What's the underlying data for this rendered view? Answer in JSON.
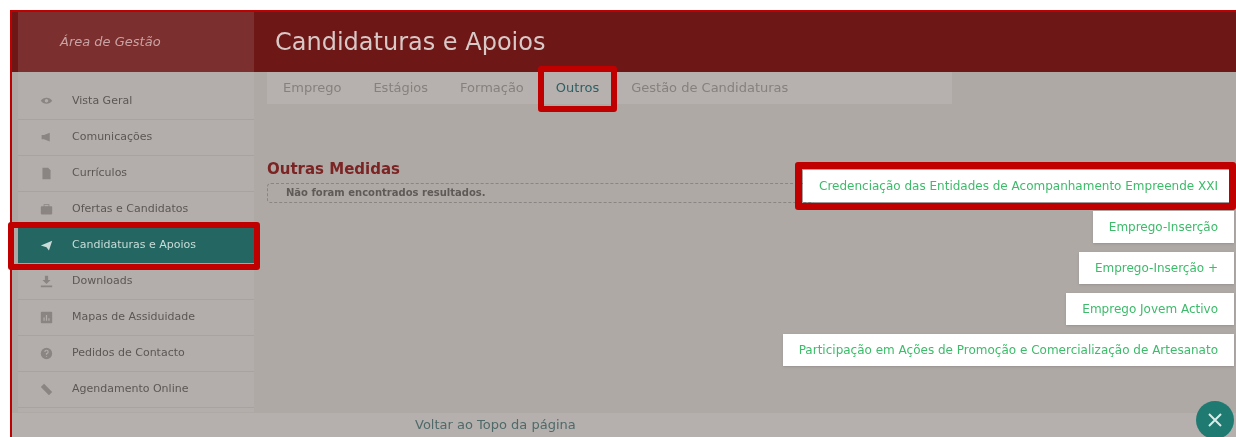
{
  "sidebar": {
    "title": "Área de Gestão",
    "items": [
      {
        "label": "Vista Geral",
        "selected": false,
        "highlighted": false
      },
      {
        "label": "Comunicações",
        "selected": false,
        "highlighted": false
      },
      {
        "label": "Currículos",
        "selected": false,
        "highlighted": false
      },
      {
        "label": "Ofertas e Candidatos",
        "selected": false,
        "highlighted": false
      },
      {
        "label": "Candidaturas e Apoios",
        "selected": true,
        "highlighted": true
      },
      {
        "label": "Downloads",
        "selected": false,
        "highlighted": false
      },
      {
        "label": "Mapas de Assiduidade",
        "selected": false,
        "highlighted": false
      },
      {
        "label": "Pedidos de Contacto",
        "selected": false,
        "highlighted": false
      },
      {
        "label": "Agendamento Online",
        "selected": false,
        "highlighted": false
      }
    ]
  },
  "header": {
    "title": "Candidaturas e Apoios"
  },
  "tabs": [
    {
      "label": "Emprego",
      "selected": false,
      "highlighted": false
    },
    {
      "label": "Estágios",
      "selected": false,
      "highlighted": false
    },
    {
      "label": "Formação",
      "selected": false,
      "highlighted": false
    },
    {
      "label": "Outros",
      "selected": true,
      "highlighted": true
    },
    {
      "label": "Gestão de Candidaturas",
      "selected": false,
      "highlighted": false
    }
  ],
  "section": {
    "title": "Outras Medidas",
    "empty_message": "Não foram encontrados resultados."
  },
  "measures": [
    {
      "label": "Credenciação das Entidades de Acompanhamento Empreende XXI",
      "highlighted": true
    },
    {
      "label": "Emprego-Inserção",
      "highlighted": false
    },
    {
      "label": "Emprego-Inserção +",
      "highlighted": false
    },
    {
      "label": "Emprego Jovem Activo",
      "highlighted": false
    },
    {
      "label": "Participação em Ações de Promoção e Comercialização de Artesanato",
      "highlighted": false
    }
  ],
  "footer": {
    "back_to_top": "Voltar ao Topo da página"
  }
}
